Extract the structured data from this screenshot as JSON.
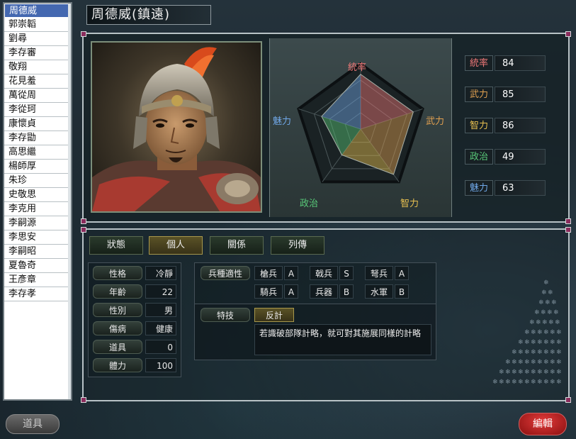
{
  "officer_list": {
    "selected_index": 0,
    "items": [
      "周德威",
      "郭崇韜",
      "劉尋",
      "李存審",
      "敬翔",
      "花見羞",
      "萬從周",
      "李從珂",
      "康懷貞",
      "李存勖",
      "高思繼",
      "楊師厚",
      "朱珍",
      "史敬思",
      "李克用",
      "李嗣源",
      "李思安",
      "李嗣昭",
      "夏魯奇",
      "王彥章",
      "李存孝"
    ]
  },
  "header": {
    "name": "周德威(鎮遠)"
  },
  "radar": {
    "labels": {
      "top": "統率",
      "right": "武力",
      "bottom_right": "智力",
      "bottom_left": "政治",
      "left": "魅力"
    },
    "label_colors": {
      "top": "#f07878",
      "right": "#e0a050",
      "bottom_right": "#e8c050",
      "bottom_left": "#58c878",
      "left": "#70a8e8"
    }
  },
  "stats": [
    {
      "label": "統率",
      "value": "84",
      "color": "#f07878"
    },
    {
      "label": "武力",
      "value": "85",
      "color": "#e0a050"
    },
    {
      "label": "智力",
      "value": "86",
      "color": "#e8c050"
    },
    {
      "label": "政治",
      "value": "49",
      "color": "#58c878"
    },
    {
      "label": "魅力",
      "value": "63",
      "color": "#70a8e8"
    }
  ],
  "tabs": [
    {
      "label": "狀態",
      "active": false
    },
    {
      "label": "個人",
      "active": true
    },
    {
      "label": "關係",
      "active": false
    },
    {
      "label": "列傳",
      "active": false
    }
  ],
  "personal": [
    {
      "label": "性格",
      "value": "冷靜"
    },
    {
      "label": "年齡",
      "value": "22"
    },
    {
      "label": "性別",
      "value": "男"
    },
    {
      "label": "傷病",
      "value": "健康"
    },
    {
      "label": "道具",
      "value": "0"
    },
    {
      "label": "體力",
      "value": "100"
    }
  ],
  "aptitude": {
    "title": "兵種適性",
    "rows": [
      [
        {
          "name": "槍兵",
          "grade": "A"
        },
        {
          "name": "戟兵",
          "grade": "S"
        },
        {
          "name": "弩兵",
          "grade": "A"
        }
      ],
      [
        {
          "name": "騎兵",
          "grade": "A"
        },
        {
          "name": "兵器",
          "grade": "B"
        },
        {
          "name": "水軍",
          "grade": "B"
        }
      ]
    ]
  },
  "skill": {
    "label": "特技",
    "name": "反計",
    "description": "若識破部隊計略，就可對其施展同樣的計略"
  },
  "buttons": {
    "items": "道具",
    "edit": "編輯"
  }
}
